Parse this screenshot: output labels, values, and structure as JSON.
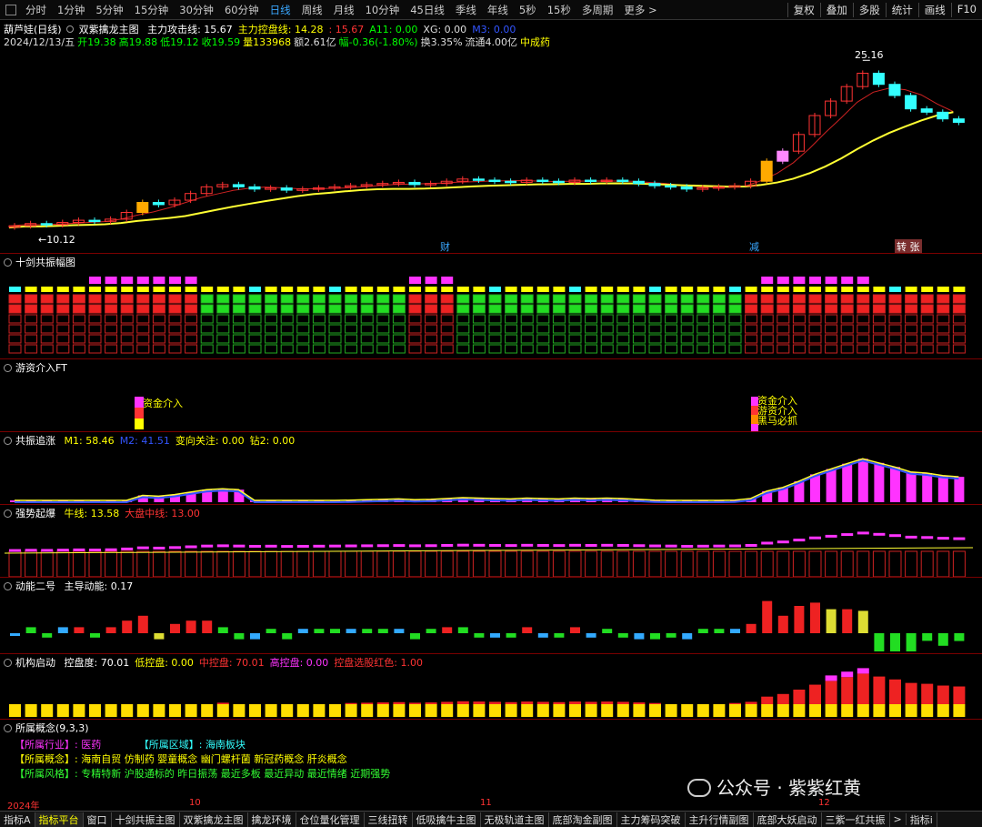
{
  "toolbar": {
    "timeframes": [
      "分时",
      "1分钟",
      "5分钟",
      "15分钟",
      "30分钟",
      "60分钟",
      "日线",
      "周线",
      "月线",
      "10分钟",
      "45日线",
      "季线",
      "年线",
      "5秒",
      "15秒",
      "多周期",
      "更多 >"
    ],
    "active_timeframe": "日线",
    "right_buttons": [
      "复权",
      "叠加",
      "多股",
      "统计",
      "画线",
      "F10"
    ]
  },
  "main": {
    "title": "葫芦娃(日线)",
    "indicator_name": "双紫擒龙主图",
    "line1": [
      {
        "text": "主力攻击线: 15.67",
        "color": "#ffffff"
      },
      {
        "text": "主力控盘线: 14.28",
        "color": "#ffff00"
      },
      {
        "text": ": 15.67",
        "color": "#ff3333"
      },
      {
        "text": "A11: 0.00",
        "color": "#00ff00"
      },
      {
        "text": "XG: 0.00",
        "color": "#dddddd"
      },
      {
        "text": "M3: 0.00",
        "color": "#3355ff"
      }
    ],
    "line2": [
      {
        "text": "2024/12/13/五",
        "color": "#dddddd"
      },
      {
        "text": "开19.38",
        "color": "#00ff00"
      },
      {
        "text": "高19.88",
        "color": "#00ff00"
      },
      {
        "text": "低19.12",
        "color": "#00ff00"
      },
      {
        "text": "收19.59",
        "color": "#00ff00"
      },
      {
        "text": "量133968",
        "color": "#ffff00"
      },
      {
        "text": "额2.61亿",
        "color": "#dddddd"
      },
      {
        "text": "幅-0.36(-1.80%)",
        "color": "#00ff00"
      },
      {
        "text": "换3.35%",
        "color": "#dddddd"
      },
      {
        "text": "流通4.00亿",
        "color": "#dddddd"
      },
      {
        "text": "中成药",
        "color": "#ffff00"
      }
    ],
    "high_label": "25.16",
    "low_label": "←10.12",
    "markers": [
      "财",
      "减",
      "转 张"
    ]
  },
  "panels": [
    {
      "name": "十剑共振幅图",
      "items": []
    },
    {
      "name": "游资介入FT",
      "items": [],
      "labels": [
        "资金介入",
        "资金介入",
        "游资介入",
        "黑马必抓"
      ]
    },
    {
      "name": "共振追涨",
      "items": [
        {
          "text": "M1: 58.46",
          "color": "#ffff00"
        },
        {
          "text": "M2: 41.51",
          "color": "#3355ff"
        },
        {
          "text": "变向关注: 0.00",
          "color": "#ffff00"
        },
        {
          "text": "钻2: 0.00",
          "color": "#ffff00"
        }
      ]
    },
    {
      "name": "强势起爆",
      "items": [
        {
          "text": "牛线: 13.58",
          "color": "#ffff00"
        },
        {
          "text": "大盘中线: 13.00",
          "color": "#ff3333"
        }
      ]
    },
    {
      "name": "动能二号",
      "items": [
        {
          "text": "主导动能: 0.17",
          "color": "#ffffff"
        }
      ]
    },
    {
      "name": "机构启动",
      "items": [
        {
          "text": "控盘度: 70.01",
          "color": "#ffffff"
        },
        {
          "text": "低控盘: 0.00",
          "color": "#ffff00"
        },
        {
          "text": "中控盘: 70.01",
          "color": "#ff3333"
        },
        {
          "text": "高控盘: 0.00",
          "color": "#ff33ff"
        },
        {
          "text": "控盘选股红色: 1.00",
          "color": "#ff3333"
        }
      ]
    },
    {
      "name": "所属概念(9,3,3)",
      "items": []
    }
  ],
  "concepts": {
    "industry_label": "【所属行业】:",
    "industry": "医药",
    "region_label": "【所属区域】:",
    "region": "海南板块",
    "concept_label": "【所属概念】:",
    "concept": "海南自贸 仿制药 婴童概念 幽门螺杆菌 新冠药概念 肝炎概念",
    "style_label": "【所属风格】:",
    "style": "专精特新 沪股通标的 昨日振荡 最近多板 最近异动 最近情绪 近期强势"
  },
  "watermark": "公众号 · 紫紫红黄",
  "date_axis": [
    "2024年",
    "10",
    "11",
    "12"
  ],
  "bottom_tabs": [
    "指标A",
    "指标平台",
    "窗口",
    "十剑共振主图",
    "双紫擒龙主图",
    "擒龙环境",
    "仓位量化管理",
    "三线扭转",
    "低吸擒牛主图",
    "无极轨道主图",
    "底部淘金副图",
    "主力筹码突破",
    "主升行情副图",
    "底部大妖启动",
    "三紫一红共振",
    ">",
    "指标i"
  ],
  "active_tab": "指标平台",
  "chart_data": {
    "type": "candlestick",
    "title": "葫芦娃(日线)",
    "n_bars": 60,
    "close": [
      10.3,
      10.5,
      10.4,
      10.6,
      10.8,
      10.7,
      10.9,
      11.5,
      12.4,
      12.2,
      12.6,
      13.2,
      13.8,
      14.0,
      13.8,
      13.6,
      13.7,
      13.5,
      13.6,
      13.7,
      13.8,
      13.9,
      14.0,
      14.1,
      14.2,
      14.0,
      14.1,
      14.3,
      14.5,
      14.4,
      14.3,
      14.2,
      14.4,
      14.3,
      14.2,
      14.4,
      14.3,
      14.4,
      14.3,
      14.1,
      13.9,
      13.8,
      13.6,
      13.7,
      13.8,
      13.9,
      14.3,
      16.1,
      17.0,
      18.5,
      20.2,
      21.5,
      22.8,
      24.0,
      23.0,
      22.0,
      20.8,
      20.5,
      19.9,
      19.59
    ],
    "ylim": [
      9.5,
      26
    ],
    "high_label": 25.16,
    "low_label": 10.12
  }
}
